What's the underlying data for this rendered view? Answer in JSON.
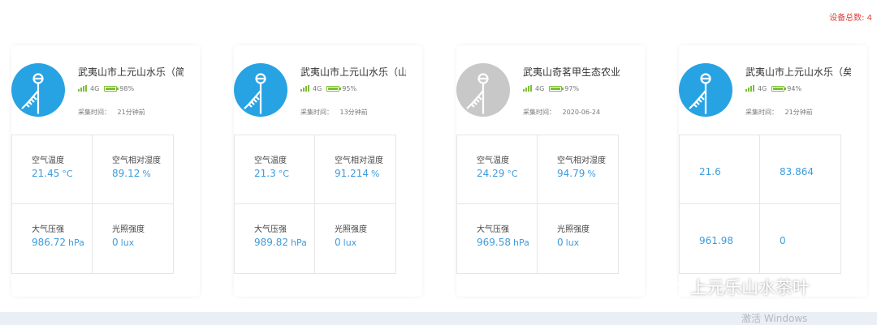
{
  "header": {
    "device_total": "设备总数: 4"
  },
  "devices": [
    {
      "name": "武夷山市上元山水乐（简",
      "network": "4G",
      "battery": "98%",
      "battery_fraction": 0.98,
      "online": true,
      "collect_label": "采集时间：",
      "collect_time": "21分钟前",
      "readings": [
        {
          "label": "空气温度",
          "value": "21.45",
          "unit": "°C"
        },
        {
          "label": "空气相对湿度",
          "value": "89.12",
          "unit": "%"
        },
        {
          "label": "大气压强",
          "value": "986.72",
          "unit": "hPa"
        },
        {
          "label": "光照强度",
          "value": "0",
          "unit": "lux"
        }
      ]
    },
    {
      "name": "武夷山市上元山水乐（山",
      "network": "4G",
      "battery": "95%",
      "battery_fraction": 0.95,
      "online": true,
      "collect_label": "采集时间：",
      "collect_time": "13分钟前",
      "readings": [
        {
          "label": "空气温度",
          "value": "21.3",
          "unit": "°C"
        },
        {
          "label": "空气相对湿度",
          "value": "91.214",
          "unit": "%"
        },
        {
          "label": "大气压强",
          "value": "989.82",
          "unit": "hPa"
        },
        {
          "label": "光照强度",
          "value": "0",
          "unit": "lux"
        }
      ]
    },
    {
      "name": "武夷山奇茗甲生态农业",
      "network": "4G",
      "battery": "97%",
      "battery_fraction": 0.97,
      "online": false,
      "collect_label": "采集时间：",
      "collect_time": "2020-06-24",
      "readings": [
        {
          "label": "空气温度",
          "value": "24.29",
          "unit": "°C"
        },
        {
          "label": "空气相对湿度",
          "value": "94.79",
          "unit": "%"
        },
        {
          "label": "大气压强",
          "value": "969.58",
          "unit": "hPa"
        },
        {
          "label": "光照强度",
          "value": "0",
          "unit": "lux"
        }
      ]
    },
    {
      "name": "武夷山市上元山水乐（矣",
      "network": "4G",
      "battery": "94%",
      "battery_fraction": 0.94,
      "online": true,
      "collect_label": "采集时间：",
      "collect_time": "21分钟前",
      "readings": [
        {
          "label": "",
          "value": "21.6",
          "unit": ""
        },
        {
          "label": "",
          "value": "83.864",
          "unit": ""
        },
        {
          "label": "",
          "value": "961.98",
          "unit": ""
        },
        {
          "label": "",
          "value": "0",
          "unit": ""
        }
      ]
    }
  ],
  "watermark": {
    "text": "上元乐山水茶叶"
  },
  "os_notice": {
    "text": "激活 Windows"
  },
  "colors": {
    "accent_blue": "#27a3e4",
    "value_blue": "#3d9bdc",
    "offline_gray": "#c8c8c8",
    "battery_green": "#7cbf33",
    "alert_red": "#e0403b"
  }
}
